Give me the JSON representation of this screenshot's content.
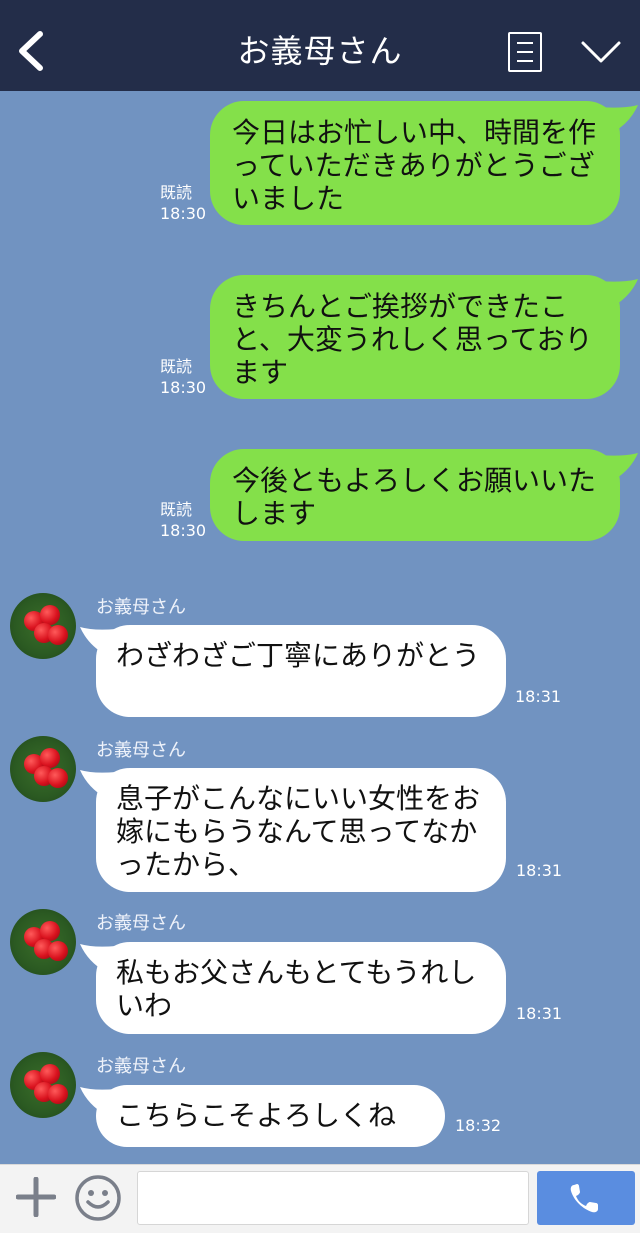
{
  "header": {
    "title": "お義母さん"
  },
  "outgoing": [
    {
      "text": "今日はお忙しい中、時間を作っていただきありがとうございました",
      "read_label": "既読",
      "time": "18:30"
    },
    {
      "text": "きちんとご挨拶ができたこと、大変うれしく思っております",
      "read_label": "既読",
      "time": "18:30"
    },
    {
      "text": "今後ともよろしくお願いいたします",
      "read_label": "既読",
      "time": "18:30"
    }
  ],
  "incoming": [
    {
      "sender": "お義母さん",
      "text": "わざわざご丁寧にありがとう",
      "time": "18:31"
    },
    {
      "sender": "お義母さん",
      "text": "息子がこんなにいい女性をお嫁にもらうなんて思ってなかったから、",
      "time": "18:31"
    },
    {
      "sender": "お義母さん",
      "text": "私もお父さんもとてもうれしいわ",
      "time": "18:31"
    },
    {
      "sender": "お義母さん",
      "text": "こちらこそよろしくね",
      "time": "18:32"
    }
  ],
  "footer": {
    "input_value": ""
  },
  "colors": {
    "header_bg": "#232d49",
    "chat_bg": "#7193c1",
    "outgoing_bubble": "#84e04a",
    "incoming_bubble": "#ffffff",
    "call_button": "#5a8de0"
  },
  "icons": [
    "back-chevron-icon",
    "menu-list-icon",
    "chevron-down-icon",
    "plus-icon",
    "emoji-icon",
    "phone-icon"
  ]
}
